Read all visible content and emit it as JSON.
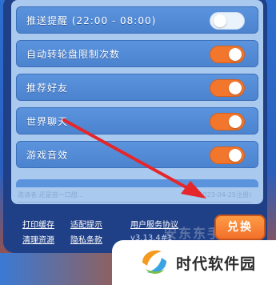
{
  "settings": [
    {
      "label": "推送提醒 (22:00 - 08:00)",
      "state": "off"
    },
    {
      "label": "自动转轮盘限制次数",
      "state": "on"
    },
    {
      "label": "推荐好友",
      "state": "on"
    },
    {
      "label": "世界聊天",
      "state": "on"
    },
    {
      "label": "游戏音效",
      "state": "on"
    }
  ],
  "invite": {
    "text": "邀请者:还是尝一口甜...",
    "registered": "(2023-04-25注册)"
  },
  "links": {
    "print_cache": "打印缓存",
    "adapt_tip": "适配提示",
    "clean_resources": "清理资源",
    "privacy": "隐私条款",
    "user_agreement": "用户服务协议"
  },
  "version": "v3.13.4#1",
  "redeem_label": "兑换",
  "watermark": "安东东手游",
  "brand_name": "时代软件园",
  "colors": {
    "toggle_on": "#f2772d",
    "row_bg": "#4b83cf",
    "panel_bg": "#a9c9ee",
    "arrow": "#e5262a"
  }
}
